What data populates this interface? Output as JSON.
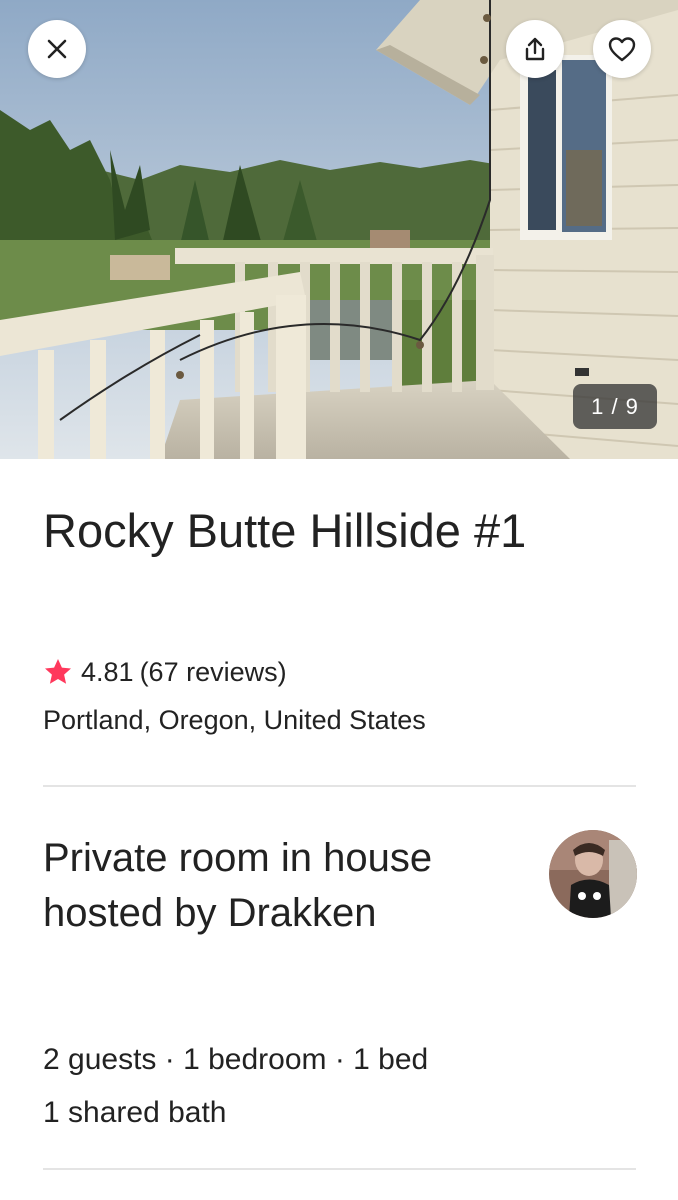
{
  "gallery": {
    "counter": "1 / 9"
  },
  "icons": {
    "close": "close-icon",
    "share": "share-icon",
    "save": "heart-icon",
    "rating": "star-icon"
  },
  "listing": {
    "title": "Rocky Butte Hillside #1",
    "rating": "4.81",
    "reviews": "(67 reviews)",
    "location": "Portland, Oregon, United States"
  },
  "room": {
    "heading_line1": "Private room in house",
    "heading_line2": "hosted by Drakken",
    "details_line1": "2 guests · 1 bedroom · 1 bed",
    "details_line2": "1 shared bath"
  },
  "colors": {
    "star": "#FF385C",
    "text": "#222222",
    "divider": "#E4E4E4"
  }
}
